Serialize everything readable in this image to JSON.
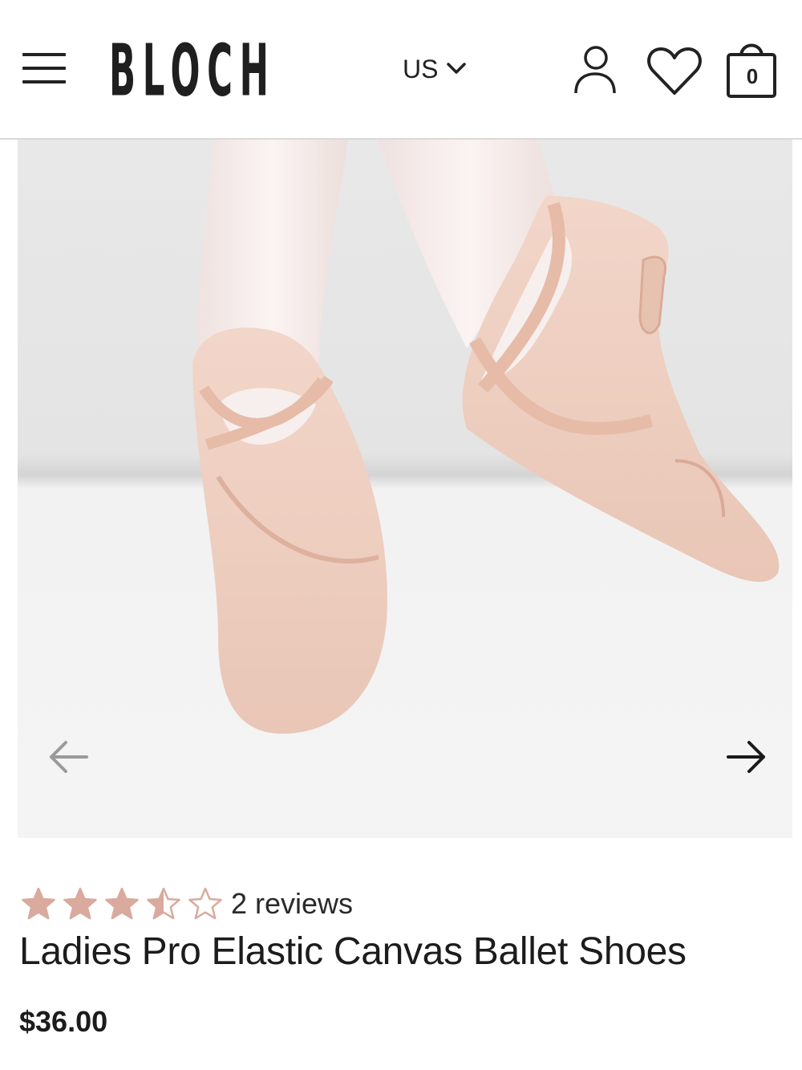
{
  "header": {
    "brand": "BLOCH",
    "region": "US",
    "bag_count": "0"
  },
  "icons": {
    "menu": "hamburger-menu-icon",
    "region_dropdown": "chevron-down-icon",
    "account": "user-icon",
    "wishlist": "heart-icon",
    "bag": "shopping-bag-icon",
    "prev": "arrow-left-icon",
    "next": "arrow-right-icon"
  },
  "product": {
    "rating": 3.5,
    "rating_max": 5,
    "reviews_label": "2 reviews",
    "title": "Ladies Pro Elastic Canvas Ballet Shoes",
    "price": "$36.00"
  },
  "colors": {
    "star": "#d9aa9d",
    "accent_text": "#1c1c1c",
    "shoe": "#f0d0c2",
    "image_background": "#ececec"
  }
}
